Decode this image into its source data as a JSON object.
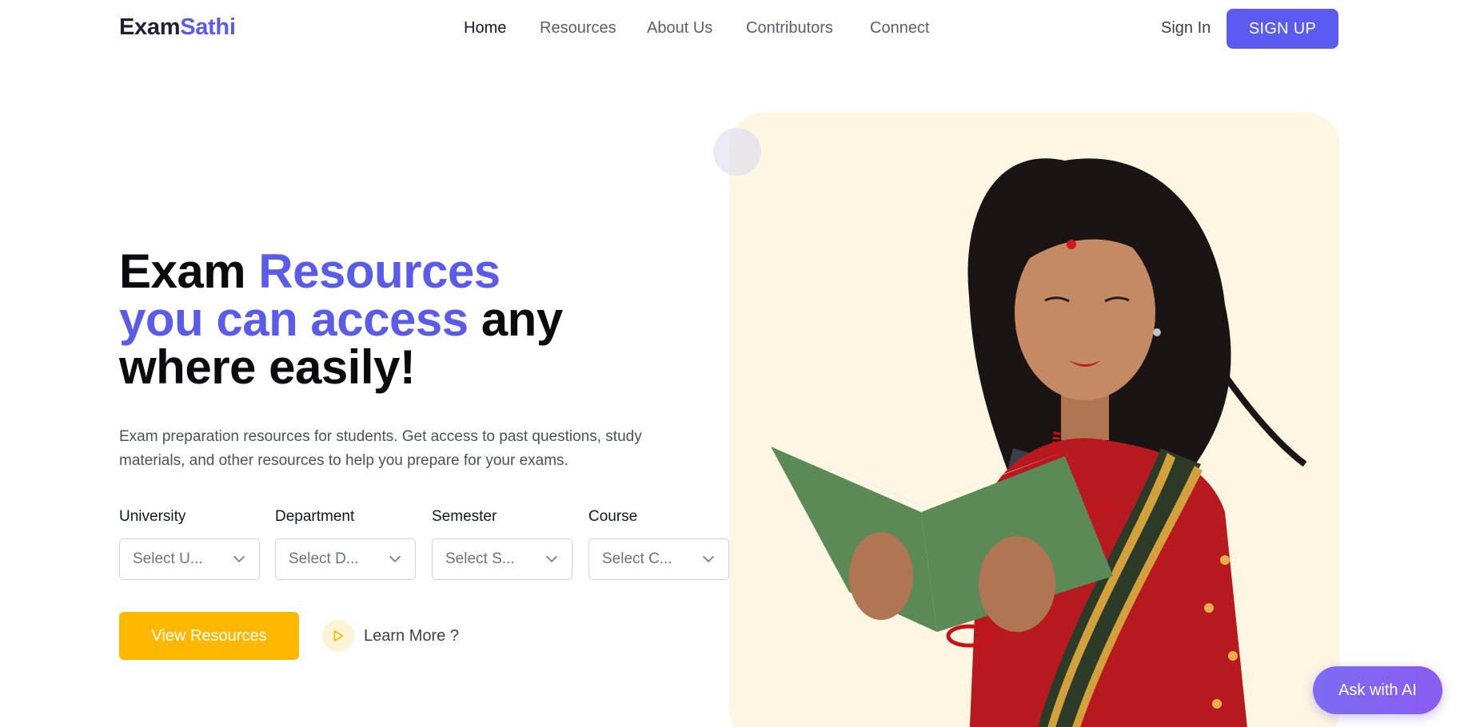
{
  "brand": {
    "part1": "Exam",
    "part2": "Sathi"
  },
  "nav": [
    {
      "label": "Home",
      "active": true
    },
    {
      "label": "Resources",
      "active": false
    },
    {
      "label": "About Us",
      "active": false
    },
    {
      "label": "Contributors",
      "active": false
    },
    {
      "label": "Connect",
      "active": false
    }
  ],
  "auth": {
    "signin": "Sign In",
    "signup": "SIGN UP"
  },
  "hero": {
    "title_part1": "Exam ",
    "title_part2": "Resources",
    "title_part3": "you can access",
    "title_part4": " any",
    "title_part5": "where easily!",
    "description": "Exam preparation resources for students. Get access to past questions, study materials, and other resources to help you prepare for your exams."
  },
  "filters": [
    {
      "label": "University",
      "placeholder": "Select U..."
    },
    {
      "label": "Department",
      "placeholder": "Select D..."
    },
    {
      "label": "Semester",
      "placeholder": "Select S..."
    },
    {
      "label": "Course",
      "placeholder": "Select C..."
    }
  ],
  "cta": {
    "view": "View Resources",
    "learn": "Learn More ?"
  },
  "ask_ai": "Ask with AI",
  "colors": {
    "accent": "#5b5bea",
    "cta": "#ffb800",
    "panel": "#fdf6e3"
  }
}
